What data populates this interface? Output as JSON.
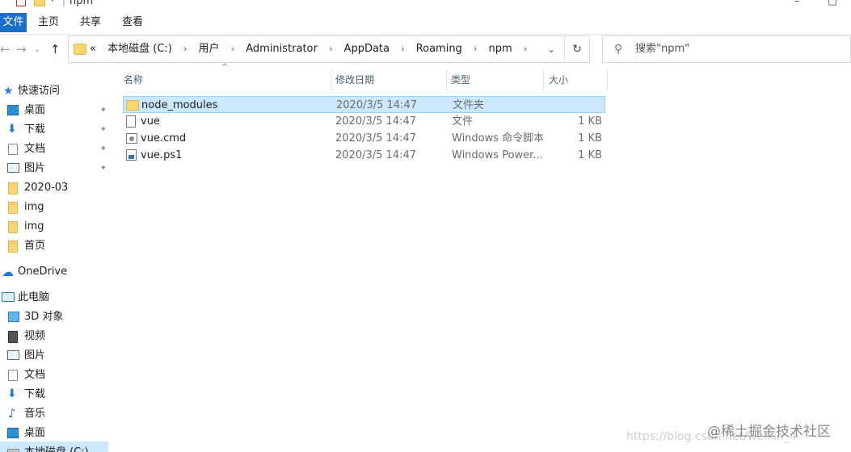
{
  "window": {
    "title": "npm",
    "minimize": "–",
    "maximize": "□"
  },
  "ribbon": {
    "tabs": [
      "文件",
      "主页",
      "共享",
      "查看"
    ]
  },
  "nav": {
    "back": "←",
    "forward": "→",
    "up": "↑"
  },
  "address": {
    "overflow": "«",
    "crumbs": [
      "本地磁盘 (C:)",
      "用户",
      "Administrator",
      "AppData",
      "Roaming",
      "npm"
    ],
    "separator": "›",
    "dropdown": "⌄",
    "refresh": "↻"
  },
  "search": {
    "placeholder": "搜索\"npm\""
  },
  "sidebar": {
    "items": [
      {
        "label": "快速访问",
        "icon": "star-icon"
      },
      {
        "label": "桌面",
        "icon": "desktop-icon",
        "pinned": true
      },
      {
        "label": "下载",
        "icon": "download-icon",
        "pinned": true
      },
      {
        "label": "文档",
        "icon": "document-icon",
        "pinned": true
      },
      {
        "label": "图片",
        "icon": "pictures-icon",
        "pinned": true
      },
      {
        "label": "2020-03",
        "icon": "folder-icon"
      },
      {
        "label": "img",
        "icon": "folder-icon"
      },
      {
        "label": "img",
        "icon": "folder-icon"
      },
      {
        "label": "首页",
        "icon": "folder-icon"
      },
      {
        "label": "OneDrive",
        "icon": "cloud-icon"
      },
      {
        "label": "此电脑",
        "icon": "computer-icon"
      },
      {
        "label": "3D 对象",
        "icon": "cube-icon"
      },
      {
        "label": "视频",
        "icon": "video-icon"
      },
      {
        "label": "图片",
        "icon": "pictures-icon"
      },
      {
        "label": "文档",
        "icon": "document-icon"
      },
      {
        "label": "下载",
        "icon": "download-icon"
      },
      {
        "label": "音乐",
        "icon": "music-icon"
      },
      {
        "label": "桌面",
        "icon": "desktop-icon"
      },
      {
        "label": "本地磁盘 (C:)",
        "icon": "disk-icon"
      }
    ],
    "pin_glyph": "✦"
  },
  "filelist": {
    "columns": {
      "name": "名称",
      "date": "修改日期",
      "type": "类型",
      "size": "大小"
    },
    "sort_indicator": "^",
    "rows": [
      {
        "name": "node_modules",
        "date": "2020/3/5 14:47",
        "type": "文件夹",
        "size": "",
        "icon": "folder-icon",
        "selected": true
      },
      {
        "name": "vue",
        "date": "2020/3/5 14:47",
        "type": "文件",
        "size": "1 KB",
        "icon": "file-icon"
      },
      {
        "name": "vue.cmd",
        "date": "2020/3/5 14:47",
        "type": "Windows 命令脚本",
        "size": "1 KB",
        "icon": "cmd-script-icon"
      },
      {
        "name": "vue.ps1",
        "date": "2020/3/5 14:47",
        "type": "Windows Power...",
        "size": "1 KB",
        "icon": "powershell-icon"
      }
    ]
  },
  "watermark": {
    "main": "@稀土掘金技术社区",
    "sub": "https://blog.csdn.net/weixin_4"
  },
  "colors": {
    "accent": "#1a6fc8",
    "selection": "#cce8ff",
    "folder": "#f7d774"
  }
}
